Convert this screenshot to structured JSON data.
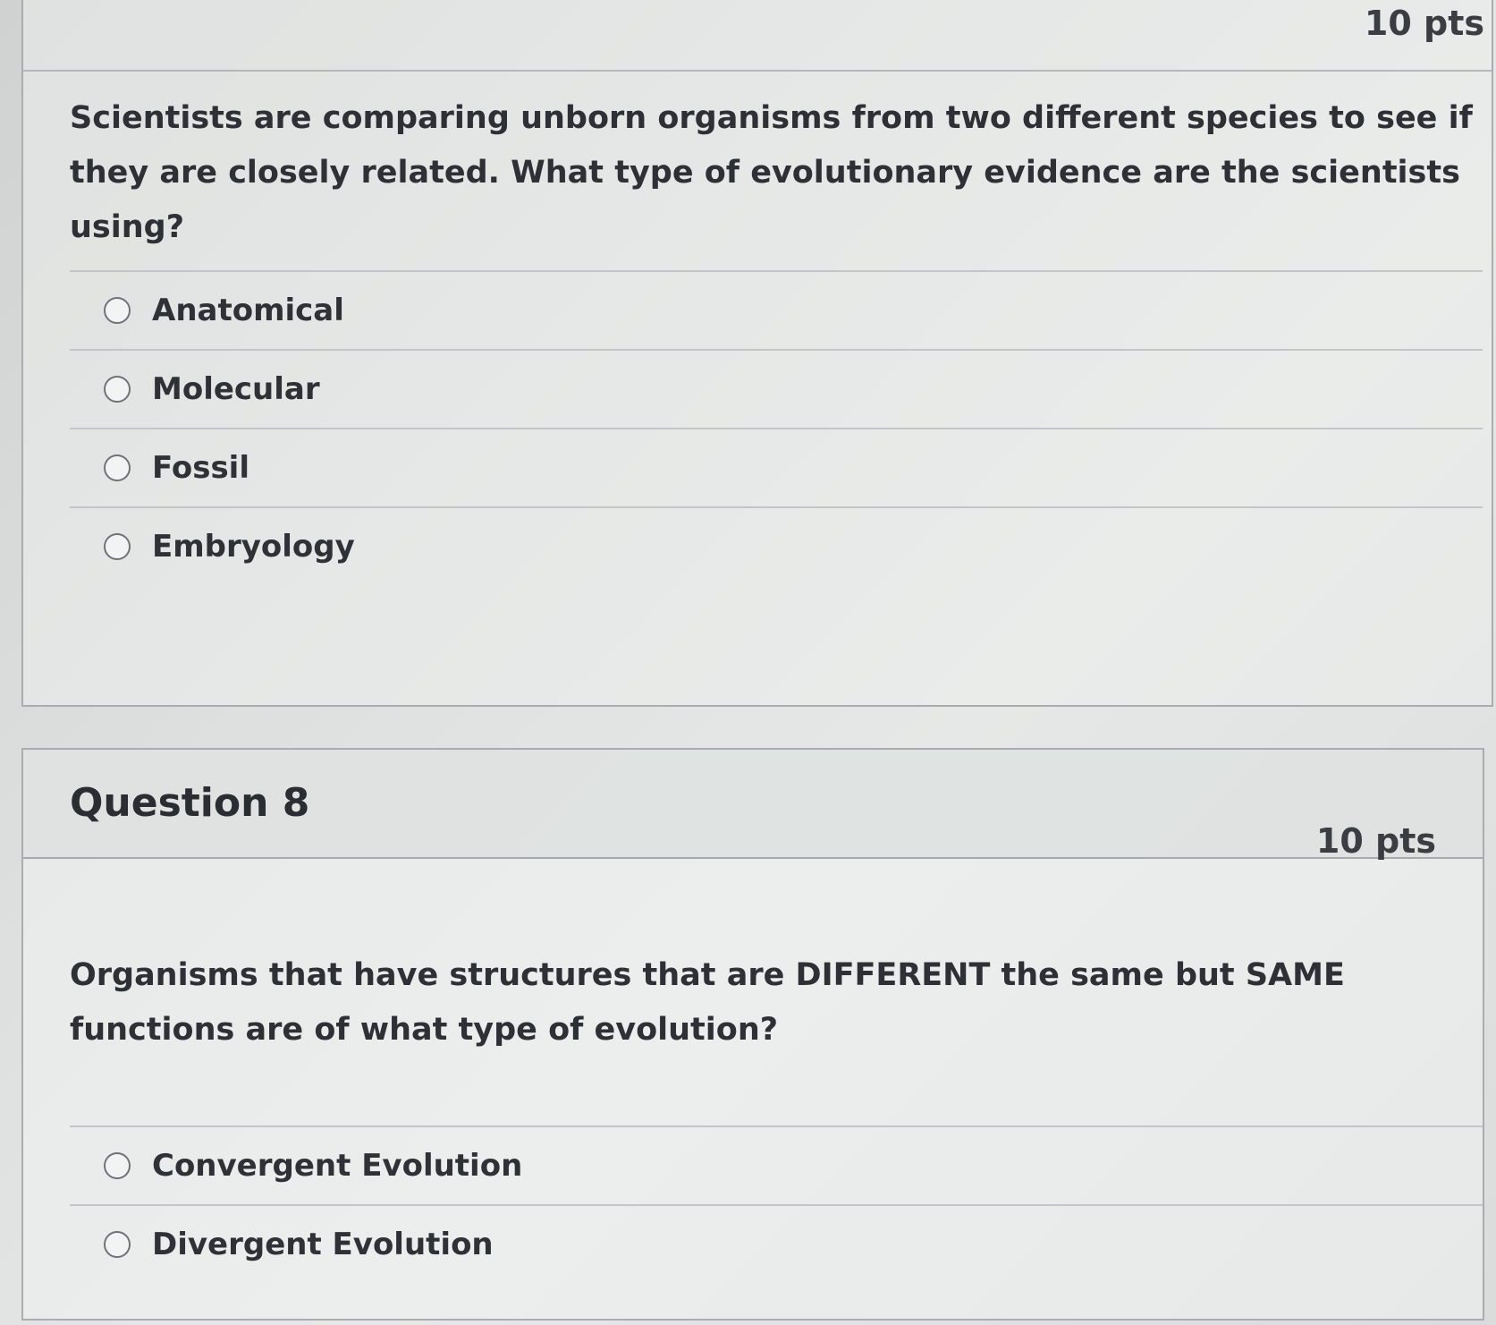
{
  "question7": {
    "points": "10 pts",
    "prompt": "Scientists are comparing unborn organisms from two different species to see if they are closely related. What type of evolutionary evidence are the scientists using?",
    "answers": [
      {
        "label": "Anatomical"
      },
      {
        "label": "Molecular"
      },
      {
        "label": "Fossil"
      },
      {
        "label": "Embryology"
      }
    ]
  },
  "question8": {
    "title": "Question 8",
    "points": "10 pts",
    "prompt": "Organisms that have structures that are DIFFERENT the same but SAME functions are of what type of evolution?",
    "answers": [
      {
        "label": "Convergent Evolution"
      },
      {
        "label": "Divergent Evolution"
      }
    ]
  }
}
